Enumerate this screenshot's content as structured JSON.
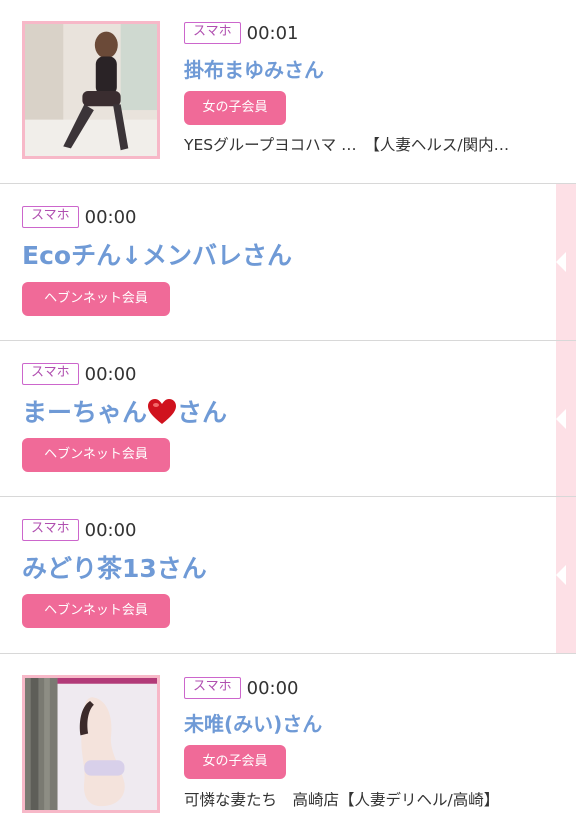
{
  "posts": [
    {
      "device": "スマホ",
      "time": "00:01",
      "name": "掛布まゆみさん",
      "member": "女の子会員",
      "shop": "YESグループヨコハマ …　【人妻ヘルス/関内…"
    },
    {
      "device": "スマホ",
      "time": "00:00",
      "name": "Ecoチん↓メンバレさん",
      "member": "ヘブンネット会員"
    },
    {
      "device": "スマホ",
      "time": "00:00",
      "name_before": "まーちゃん",
      "name_after": "さん",
      "member": "ヘブンネット会員"
    },
    {
      "device": "スマホ",
      "time": "00:00",
      "name": "みどり茶13さん",
      "member": "ヘブンネット会員"
    },
    {
      "device": "スマホ",
      "time": "00:00",
      "name": "未唯(みい)さん",
      "member": "女の子会員",
      "shop": "可憐な妻たち　高崎店【人妻デリヘル/高崎】"
    }
  ],
  "colors": {
    "name_blue": "#6f9ad6",
    "member_pink": "#f06a98",
    "badge_purple": "#cc66cc",
    "thumb_border": "#f7b8c8"
  },
  "icons": [
    "heart-icon"
  ]
}
